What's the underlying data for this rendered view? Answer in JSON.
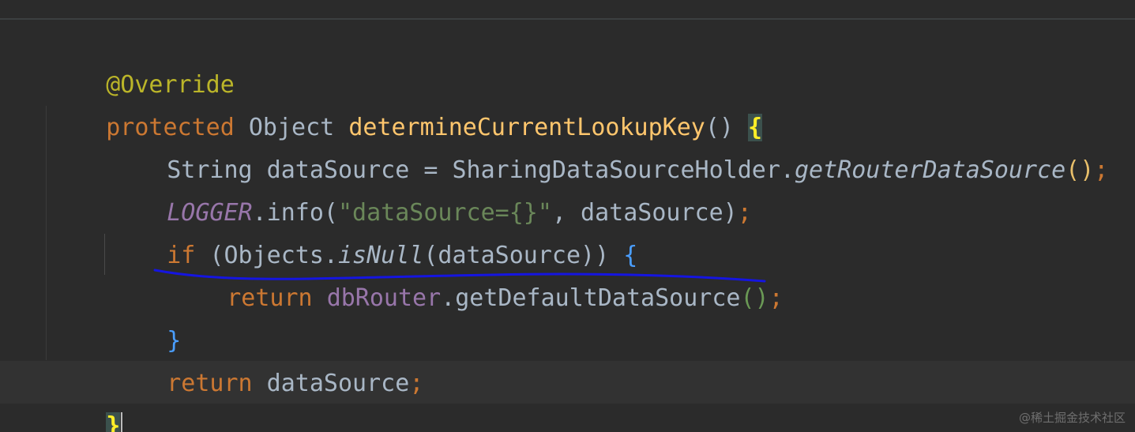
{
  "editor": {
    "language": "java",
    "watermark": "@稀土掘金技术社区",
    "colors": {
      "background": "#2b2b2b",
      "keyword": "#cc7832",
      "annotation": "#bbb529",
      "method_decl": "#ffc66d",
      "field": "#9876aa",
      "string": "#6a8759",
      "plain": "#a9b7c6",
      "underline_mark": "#1515e0"
    },
    "lines": [
      {
        "tokens": [
          "@Override"
        ]
      },
      {
        "tokens": [
          "protected",
          " Object ",
          "determineCurrentLookupKey",
          "()",
          " ",
          "{"
        ]
      },
      {
        "tokens": [
          "String dataSource = SharingDataSourceHolder.",
          "getRouterDataSource",
          "()",
          ";"
        ]
      },
      {
        "tokens": [
          "LOGGER",
          ".info(",
          "\"dataSource={}\"",
          ", dataSource)",
          ";"
        ]
      },
      {
        "tokens": [
          "if",
          " (Objects.",
          "isNull",
          "(dataSource)) ",
          "{"
        ]
      },
      {
        "tokens": [
          "return",
          " ",
          "dbRouter",
          ".getDefaultDataSource",
          "()",
          ";"
        ]
      },
      {
        "tokens": [
          "}"
        ]
      },
      {
        "tokens": [
          "return",
          " dataSource",
          ";"
        ]
      },
      {
        "tokens": [
          "}"
        ]
      }
    ]
  }
}
